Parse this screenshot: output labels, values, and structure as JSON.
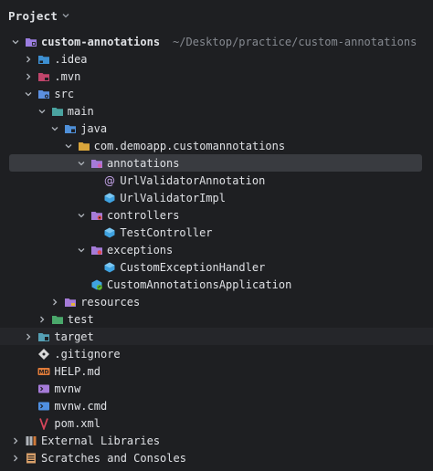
{
  "panel": {
    "title": "Project",
    "colors": {
      "background": "#1e1f22",
      "selection": "#393b40",
      "text": "#dfe1e5",
      "muted": "#868a91"
    }
  },
  "tree": [
    {
      "label": "custom-annotations",
      "path": "~/Desktop/practice/custom-annotations",
      "icon": "module-folder-icon",
      "depth": 0,
      "chevron": "down",
      "bold": true
    },
    {
      "label": ".idea",
      "icon": "idea-folder-icon",
      "depth": 1,
      "chevron": "right"
    },
    {
      "label": ".mvn",
      "icon": "mvn-folder-icon",
      "depth": 1,
      "chevron": "right"
    },
    {
      "label": "src",
      "icon": "source-folder-icon",
      "depth": 1,
      "chevron": "down"
    },
    {
      "label": "main",
      "icon": "folder-icon",
      "depth": 2,
      "chevron": "down"
    },
    {
      "label": "java",
      "icon": "java-source-root-icon",
      "depth": 3,
      "chevron": "down"
    },
    {
      "label": "com.demoapp.customannotations",
      "icon": "package-icon",
      "depth": 4,
      "chevron": "down"
    },
    {
      "label": "annotations",
      "icon": "annotations-package-icon",
      "depth": 5,
      "chevron": "down",
      "selected": true
    },
    {
      "label": "UrlValidatorAnnotation",
      "icon": "annotation-type-icon",
      "depth": 6,
      "chevron": "none"
    },
    {
      "label": "UrlValidatorImpl",
      "icon": "java-class-icon",
      "depth": 6,
      "chevron": "none"
    },
    {
      "label": "controllers",
      "icon": "controllers-package-icon",
      "depth": 5,
      "chevron": "down"
    },
    {
      "label": "TestController",
      "icon": "java-class-icon",
      "depth": 6,
      "chevron": "none"
    },
    {
      "label": "exceptions",
      "icon": "exceptions-package-icon",
      "depth": 5,
      "chevron": "down"
    },
    {
      "label": "CustomExceptionHandler",
      "icon": "java-class-icon",
      "depth": 6,
      "chevron": "none"
    },
    {
      "label": "CustomAnnotationsApplication",
      "icon": "spring-app-icon",
      "depth": 5,
      "chevron": "none"
    },
    {
      "label": "resources",
      "icon": "resources-folder-icon",
      "depth": 3,
      "chevron": "right"
    },
    {
      "label": "test",
      "icon": "test-folder-icon",
      "depth": 2,
      "chevron": "right"
    },
    {
      "label": "target",
      "icon": "target-folder-icon",
      "depth": 1,
      "chevron": "right",
      "dim": true
    },
    {
      "label": ".gitignore",
      "icon": "gitignore-icon",
      "depth": 1,
      "chevron": "none"
    },
    {
      "label": "HELP.md",
      "icon": "markdown-icon",
      "depth": 1,
      "chevron": "none"
    },
    {
      "label": "mvnw",
      "icon": "shell-script-icon",
      "depth": 1,
      "chevron": "none"
    },
    {
      "label": "mvnw.cmd",
      "icon": "cmd-script-icon",
      "depth": 1,
      "chevron": "none"
    },
    {
      "label": "pom.xml",
      "icon": "maven-pom-icon",
      "depth": 1,
      "chevron": "none"
    },
    {
      "label": "External Libraries",
      "icon": "libraries-icon",
      "depth": 0,
      "chevron": "right"
    },
    {
      "label": "Scratches and Consoles",
      "icon": "scratches-icon",
      "depth": 0,
      "chevron": "right"
    }
  ]
}
